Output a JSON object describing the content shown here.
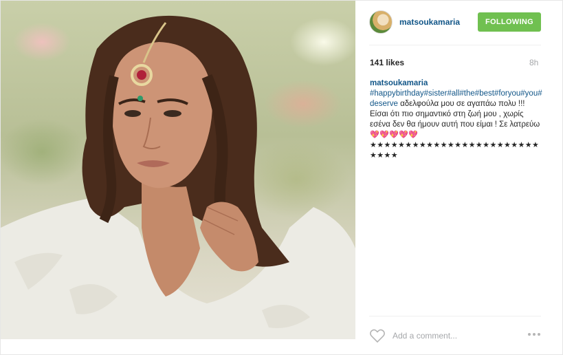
{
  "photo": {
    "subject": "woman-portrait"
  },
  "header": {
    "avatar_icon": "profile-avatar",
    "username": "matsoukamaria",
    "follow_label": "FOLLOWING",
    "follow_color": "#70c050"
  },
  "stats": {
    "likes": "141 likes",
    "time": "8h"
  },
  "caption": {
    "username": "matsoukamaria",
    "hashtags": "#happybirthday#sister#all#the#best#foryou#you#deserve",
    "text": " αδελφούλα μου σε αγαπάω πολυ !!! Είσαι ότι πιο σημαντικό στη ζωή μου , χωρίς εσένα δεν θα ήμουν αυτή που είμαι ! Σε λατρεύω ",
    "stars": "💖💖💖💖💖★★★★★★★★★★★★★★★★★★★★★★★★★★★★"
  },
  "comment": {
    "placeholder": "Add a comment...",
    "heart_icon": "heart-icon",
    "more_icon": "more-options-icon"
  },
  "colors": {
    "link": "#125688",
    "muted": "#a5a7aa",
    "border": "#efefef"
  }
}
